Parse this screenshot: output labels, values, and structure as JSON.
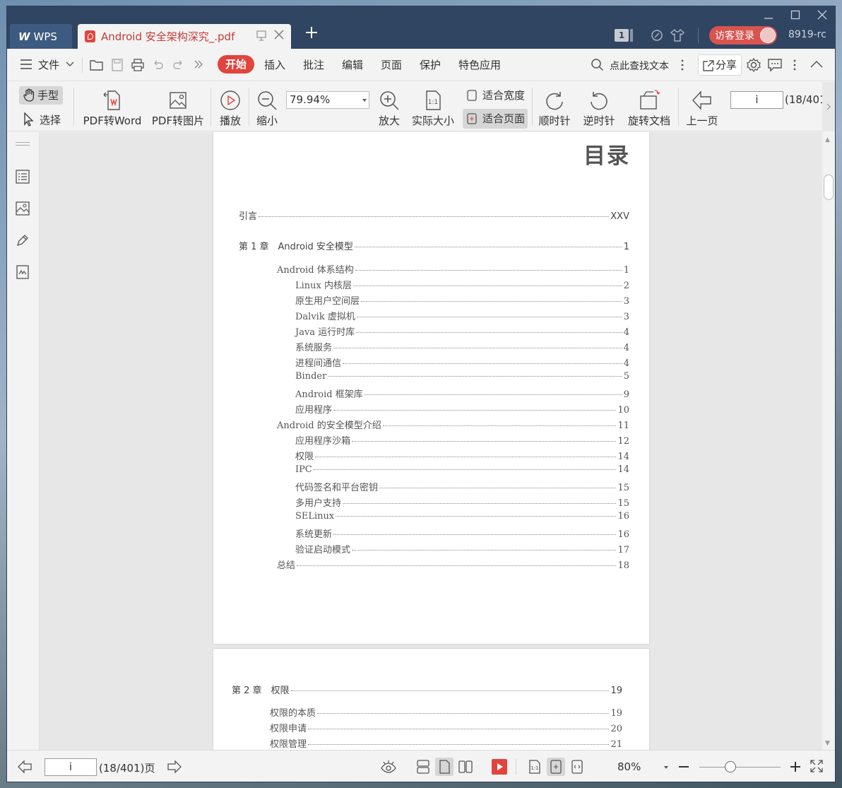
{
  "app": {
    "name": "WPS",
    "doc_tab_title": "Android 安全架构深究_.pdf",
    "version_text": "8919-rc",
    "login_label": "访客登录",
    "page_badge": "1"
  },
  "menu": {
    "file": "文件",
    "tabs": [
      "开始",
      "插入",
      "批注",
      "编辑",
      "页面",
      "保护",
      "特色应用"
    ],
    "search": "点此查找文本",
    "share": "分享"
  },
  "toolbar": {
    "hand": "手型",
    "select": "选择",
    "pdf_to_word": "PDF转Word",
    "pdf_to_image": "PDF转图片",
    "play": "播放",
    "zoom_out": "缩小",
    "zoom_value": "79.94%",
    "zoom_in": "放大",
    "actual_size": "实际大小",
    "fit_width": "适合宽度",
    "fit_page": "适合页面",
    "rotate_cw": "顺时针",
    "rotate_ccw": "逆时针",
    "rotate_doc": "旋转文档",
    "prev_page": "上一页",
    "page_input": "i",
    "page_total": "(18/401"
  },
  "document": {
    "page1": {
      "title": "目录",
      "entries": [
        {
          "label": "引言",
          "page": "XXV",
          "level": 0
        },
        {
          "label": "第 1 章　Android 安全模型",
          "page": "1",
          "level": 0
        },
        {
          "label": "Android 体系结构",
          "page": "1",
          "level": 1
        },
        {
          "label": "Linux 内核层",
          "page": "2",
          "level": 2
        },
        {
          "label": "原生用户空间层",
          "page": "3",
          "level": 2
        },
        {
          "label": "Dalvik 虚拟机",
          "page": "3",
          "level": 2
        },
        {
          "label": "Java 运行时库",
          "page": "4",
          "level": 2
        },
        {
          "label": "系统服务",
          "page": "4",
          "level": 2
        },
        {
          "label": "进程间通信",
          "page": "4",
          "level": 2
        },
        {
          "label": "Binder",
          "page": "5",
          "level": 2
        },
        {
          "label": "Android 框架库",
          "page": "9",
          "level": 2
        },
        {
          "label": "应用程序",
          "page": "10",
          "level": 2
        },
        {
          "label": "Android 的安全模型介绍",
          "page": "11",
          "level": 1
        },
        {
          "label": "应用程序沙箱",
          "page": "12",
          "level": 2
        },
        {
          "label": "权限",
          "page": "14",
          "level": 2
        },
        {
          "label": "IPC",
          "page": "14",
          "level": 2
        },
        {
          "label": "代码签名和平台密钥",
          "page": "15",
          "level": 2
        },
        {
          "label": "多用户支持",
          "page": "15",
          "level": 2
        },
        {
          "label": "SELinux",
          "page": "16",
          "level": 2
        },
        {
          "label": "系统更新",
          "page": "16",
          "level": 2
        },
        {
          "label": "验证启动模式",
          "page": "17",
          "level": 2
        },
        {
          "label": "总结",
          "page": "18",
          "level": 1
        }
      ]
    },
    "page2": {
      "entries": [
        {
          "label": "第 2 章　权限",
          "page": "19",
          "level": 0
        },
        {
          "label": "权限的本质",
          "page": "19",
          "level": 1
        },
        {
          "label": "权限申请",
          "page": "20",
          "level": 1
        },
        {
          "label": "权限管理",
          "page": "21",
          "level": 1
        }
      ]
    }
  },
  "status": {
    "page_input": "i",
    "page_total": "(18/401)页",
    "zoom": "80%"
  },
  "colors": {
    "titlebar": "#2f4562",
    "accent": "#e3433d",
    "pdf_red": "#c53a34"
  }
}
